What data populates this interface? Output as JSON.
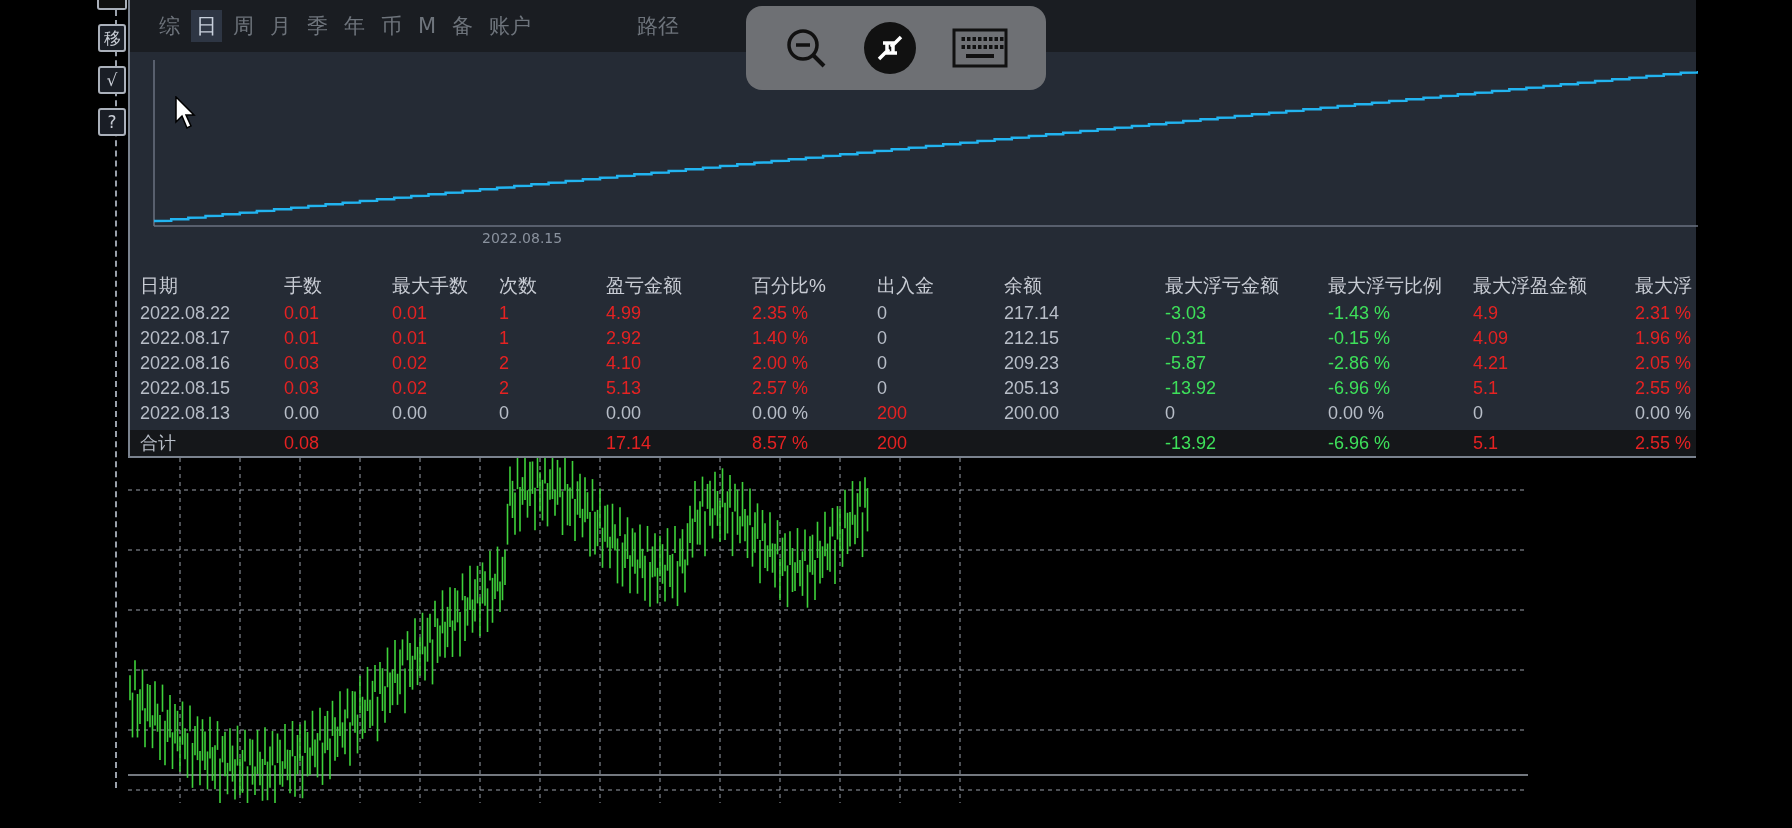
{
  "side_buttons": [
    "移",
    "√",
    "?"
  ],
  "tabs": [
    {
      "label": "综",
      "selected": false
    },
    {
      "label": "日",
      "selected": true
    },
    {
      "label": "周",
      "selected": false
    },
    {
      "label": "月",
      "selected": false
    },
    {
      "label": "季",
      "selected": false
    },
    {
      "label": "年",
      "selected": false
    },
    {
      "label": "币",
      "selected": false
    },
    {
      "label": "M",
      "selected": false
    },
    {
      "label": "备",
      "selected": false
    },
    {
      "label": "账户",
      "selected": false
    }
  ],
  "path_label": "路径",
  "equity_chart": {
    "x_label": "2022.08.15"
  },
  "table": {
    "columns": [
      "日期",
      "手数",
      "最大手数",
      "次数",
      "盈亏金额",
      "百分比%",
      "出入金",
      "余额",
      "最大浮亏金额",
      "最大浮亏比例",
      "最大浮盈金额",
      "最大浮"
    ],
    "rows": [
      {
        "cells": [
          {
            "text": "2022.08.22",
            "color": "#b8bec8"
          },
          {
            "text": "0.01",
            "color": "#e52222"
          },
          {
            "text": "0.01",
            "color": "#e52222"
          },
          {
            "text": "1",
            "color": "#e52222"
          },
          {
            "text": "4.99",
            "color": "#e52222"
          },
          {
            "text": "2.35 %",
            "color": "#e52222"
          },
          {
            "text": "0",
            "color": "#b8bec8"
          },
          {
            "text": "217.14",
            "color": "#b8bec8"
          },
          {
            "text": "-3.03",
            "color": "#3ee05a"
          },
          {
            "text": "-1.43 %",
            "color": "#3ee05a"
          },
          {
            "text": "4.9",
            "color": "#e52222"
          },
          {
            "text": "2.31 %",
            "color": "#e52222"
          }
        ]
      },
      {
        "cells": [
          {
            "text": "2022.08.17",
            "color": "#b8bec8"
          },
          {
            "text": "0.01",
            "color": "#e52222"
          },
          {
            "text": "0.01",
            "color": "#e52222"
          },
          {
            "text": "1",
            "color": "#e52222"
          },
          {
            "text": "2.92",
            "color": "#e52222"
          },
          {
            "text": "1.40 %",
            "color": "#e52222"
          },
          {
            "text": "0",
            "color": "#b8bec8"
          },
          {
            "text": "212.15",
            "color": "#b8bec8"
          },
          {
            "text": "-0.31",
            "color": "#3ee05a"
          },
          {
            "text": "-0.15 %",
            "color": "#3ee05a"
          },
          {
            "text": "4.09",
            "color": "#e52222"
          },
          {
            "text": "1.96 %",
            "color": "#e52222"
          }
        ]
      },
      {
        "cells": [
          {
            "text": "2022.08.16",
            "color": "#b8bec8"
          },
          {
            "text": "0.03",
            "color": "#e52222"
          },
          {
            "text": "0.02",
            "color": "#e52222"
          },
          {
            "text": "2",
            "color": "#e52222"
          },
          {
            "text": "4.10",
            "color": "#e52222"
          },
          {
            "text": "2.00 %",
            "color": "#e52222"
          },
          {
            "text": "0",
            "color": "#b8bec8"
          },
          {
            "text": "209.23",
            "color": "#b8bec8"
          },
          {
            "text": "-5.87",
            "color": "#3ee05a"
          },
          {
            "text": "-2.86 %",
            "color": "#3ee05a"
          },
          {
            "text": "4.21",
            "color": "#e52222"
          },
          {
            "text": "2.05 %",
            "color": "#e52222"
          }
        ]
      },
      {
        "cells": [
          {
            "text": "2022.08.15",
            "color": "#b8bec8"
          },
          {
            "text": "0.03",
            "color": "#e52222"
          },
          {
            "text": "0.02",
            "color": "#e52222"
          },
          {
            "text": "2",
            "color": "#e52222"
          },
          {
            "text": "5.13",
            "color": "#e52222"
          },
          {
            "text": "2.57 %",
            "color": "#e52222"
          },
          {
            "text": "0",
            "color": "#b8bec8"
          },
          {
            "text": "205.13",
            "color": "#b8bec8"
          },
          {
            "text": "-13.92",
            "color": "#3ee05a"
          },
          {
            "text": "-6.96 %",
            "color": "#3ee05a"
          },
          {
            "text": "5.1",
            "color": "#e52222"
          },
          {
            "text": "2.55 %",
            "color": "#e52222"
          }
        ]
      },
      {
        "cells": [
          {
            "text": "2022.08.13",
            "color": "#b8bec8"
          },
          {
            "text": "0.00",
            "color": "#b8bec8"
          },
          {
            "text": "0.00",
            "color": "#b8bec8"
          },
          {
            "text": "0",
            "color": "#b8bec8"
          },
          {
            "text": "0.00",
            "color": "#b8bec8"
          },
          {
            "text": "0.00 %",
            "color": "#b8bec8"
          },
          {
            "text": "200",
            "color": "#e52222"
          },
          {
            "text": "200.00",
            "color": "#b8bec8"
          },
          {
            "text": "0",
            "color": "#b8bec8"
          },
          {
            "text": "0.00 %",
            "color": "#b8bec8"
          },
          {
            "text": "0",
            "color": "#b8bec8"
          },
          {
            "text": "0.00 %",
            "color": "#b8bec8"
          }
        ]
      }
    ],
    "total": {
      "cells": [
        {
          "text": "合计",
          "color": "#b8bec8"
        },
        {
          "text": "0.08",
          "color": "#e52222"
        },
        null,
        null,
        {
          "text": "17.14",
          "color": "#e52222"
        },
        {
          "text": "8.57 %",
          "color": "#e52222"
        },
        {
          "text": "200",
          "color": "#e52222"
        },
        null,
        {
          "text": "-13.92",
          "color": "#3ee05a"
        },
        {
          "text": "-6.96 %",
          "color": "#3ee05a"
        },
        {
          "text": "5.1",
          "color": "#e52222"
        },
        {
          "text": "2.55 %",
          "color": "#e52222"
        }
      ]
    }
  }
}
